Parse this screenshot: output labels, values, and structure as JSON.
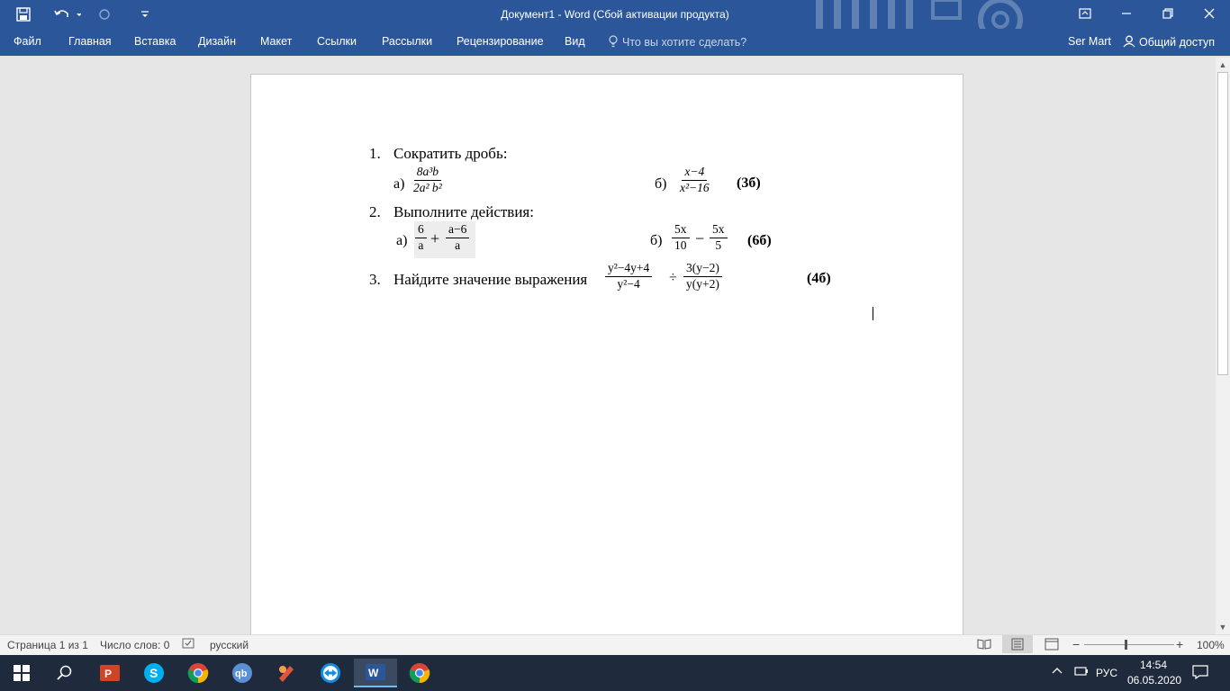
{
  "window": {
    "title": "Документ1 - Word (Сбой активации продукта)",
    "minimize_icon": "minimize-icon",
    "restore_icon": "restore-icon",
    "close_icon": "close-icon"
  },
  "ribbon": {
    "tabs": [
      "Файл",
      "Главная",
      "Вставка",
      "Дизайн",
      "Макет",
      "Ссылки",
      "Рассылки",
      "Рецензирование",
      "Вид"
    ],
    "tell_me": "Что вы хотите сделать?",
    "user": "Ser Mart",
    "share": "Общий доступ"
  },
  "document": {
    "item1": {
      "number": "1.",
      "text": "Сократить дробь:",
      "a_label": "а)",
      "a_num": "8a³b",
      "a_den": "2a²  b²",
      "b_label": "б)",
      "b_num": "x−4",
      "b_den": "x²−16",
      "points": "(3б)"
    },
    "item2": {
      "number": "2.",
      "text": "Выполните действия:",
      "a_label": "а)",
      "a_f1_num": "6",
      "a_f1_den": "a",
      "a_op": "+",
      "a_f2_num": "a−6",
      "a_f2_den": "a",
      "b_label": "б)",
      "b_f1_num": "5x",
      "b_f1_den": "10",
      "b_op": "−",
      "b_f2_num": "5x",
      "b_f2_den": "5",
      "points": "(6б)"
    },
    "item3": {
      "number": "3.",
      "text": "Найдите значение выражения",
      "f1_num": "y²−4y+4",
      "f1_den": "y²−4",
      "op": "÷",
      "f2_num": "3(y−2)",
      "f2_den": "y(y+2)",
      "points": "(4б)"
    }
  },
  "status": {
    "page": "Страница 1 из 1",
    "words": "Число слов: 0",
    "language": "русский",
    "zoom": "100%",
    "zoom_level": 1.0
  },
  "taskbar": {
    "lang": "РУС",
    "time": "14:54",
    "date": "06.05.2020"
  },
  "colors": {
    "word_blue": "#2b579a",
    "taskbar": "#1f2b3d"
  }
}
